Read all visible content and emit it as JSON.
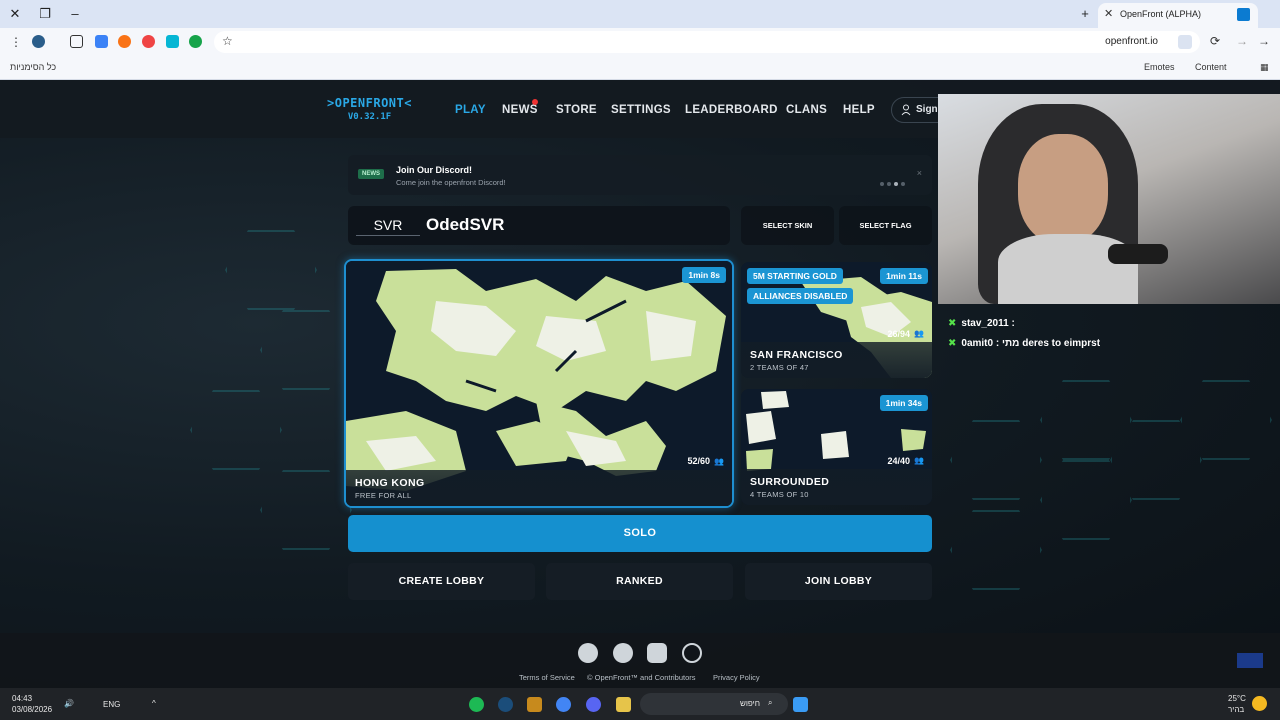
{
  "browser": {
    "tab_title": "OpenFront (ALPHA)",
    "url": "openfront.io",
    "bookmarks_right": [
      "Emotes",
      "Content"
    ],
    "bookmarks_all": "כל הסימניות"
  },
  "header": {
    "logo_line1": ">OPENFRONT<",
    "logo_line2": "V0.32.1F",
    "nav": [
      "PLAY",
      "NEWS",
      "STORE",
      "SETTINGS",
      "LEADERBOARD",
      "CLANS",
      "HELP"
    ],
    "signin": "Sign"
  },
  "news": {
    "badge": "NEWS",
    "title": "Join Our Discord!",
    "subtitle": "Come join the openfront Discord!",
    "close": "×"
  },
  "player": {
    "clan_tag": "SVR",
    "username": "OdedSVR",
    "select_skin": "SELECT SKIN",
    "select_flag": "SELECT FLAG"
  },
  "lobbies": [
    {
      "map": "HONG KONG",
      "mode": "FREE FOR ALL",
      "timer": "1min 8s",
      "players": "52/60",
      "badges": []
    },
    {
      "map": "SAN FRANCISCO",
      "mode": "2 TEAMS OF 47",
      "timer": "1min 11s",
      "players": "26/94",
      "badges": [
        "5M STARTING GOLD",
        "ALLIANCES DISABLED"
      ]
    },
    {
      "map": "SURROUNDED",
      "mode": "4 TEAMS OF 10",
      "timer": "1min 34s",
      "players": "24/40",
      "badges": []
    }
  ],
  "actions": {
    "solo": "SOLO",
    "create_lobby": "CREATE LOBBY",
    "ranked": "RANKED",
    "join_lobby": "JOIN LOBBY"
  },
  "footer": {
    "links": [
      "Terms of Service",
      "© OpenFront™ and Contributors",
      "Privacy Policy"
    ],
    "icons": [
      "github-icon",
      "reddit-icon",
      "discord-icon",
      "globe-icon"
    ]
  },
  "chat": {
    "messages": [
      {
        "user": "stav_2011",
        "text": ":"
      },
      {
        "user": "0amit0",
        "text": ": מתי deres to eimprst"
      }
    ]
  },
  "taskbar": {
    "time": "04:43",
    "date": "03/08/2026",
    "lang": "ENG",
    "search": "חיפוש",
    "weather_temp": "25°C",
    "weather_desc": "בהיר"
  },
  "colors": {
    "accent": "#1590cf",
    "logo": "#2aa8e6",
    "land": "#c9e09a",
    "water": "#0d1a2a"
  }
}
